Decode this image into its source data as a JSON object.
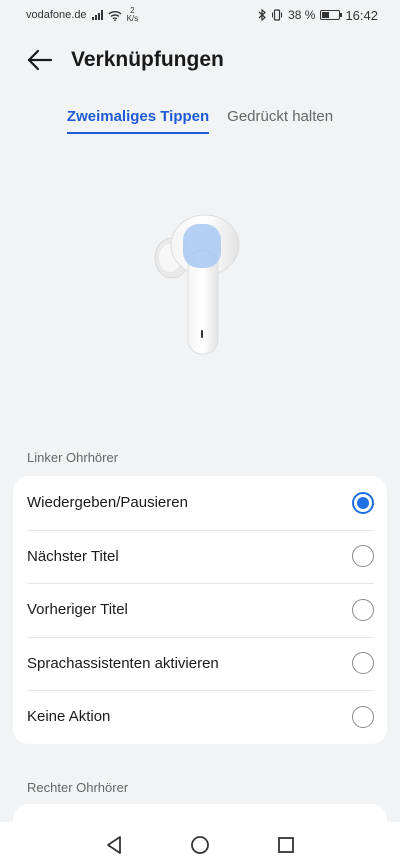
{
  "status_bar": {
    "carrier": "vodafone.de",
    "speed_value": "2",
    "speed_unit": "K/s",
    "battery_percent": "38 %",
    "battery_level": 0.38,
    "time": "16:42"
  },
  "header": {
    "title": "Verknüpfungen"
  },
  "tabs": [
    {
      "label": "Zweimaliges Tippen",
      "active": true
    },
    {
      "label": "Gedrückt halten",
      "active": false
    }
  ],
  "left_section": {
    "label": "Linker Ohrhörer",
    "options": [
      {
        "label": "Wiedergeben/Pausieren",
        "selected": true
      },
      {
        "label": "Nächster Titel",
        "selected": false
      },
      {
        "label": "Vorheriger Titel",
        "selected": false
      },
      {
        "label": "Sprachassistenten aktivieren",
        "selected": false
      },
      {
        "label": "Keine Aktion",
        "selected": false
      }
    ]
  },
  "right_section": {
    "label": "Rechter Ohrhörer"
  },
  "colors": {
    "accent": "#1f5bd6",
    "radio_selected": "#1f6fe5",
    "background": "#f1f3f5"
  },
  "icons": {
    "back": "arrow-left-icon",
    "nav_back": "triangle-back-icon",
    "nav_home": "circle-home-icon",
    "nav_recents": "square-recents-icon"
  }
}
